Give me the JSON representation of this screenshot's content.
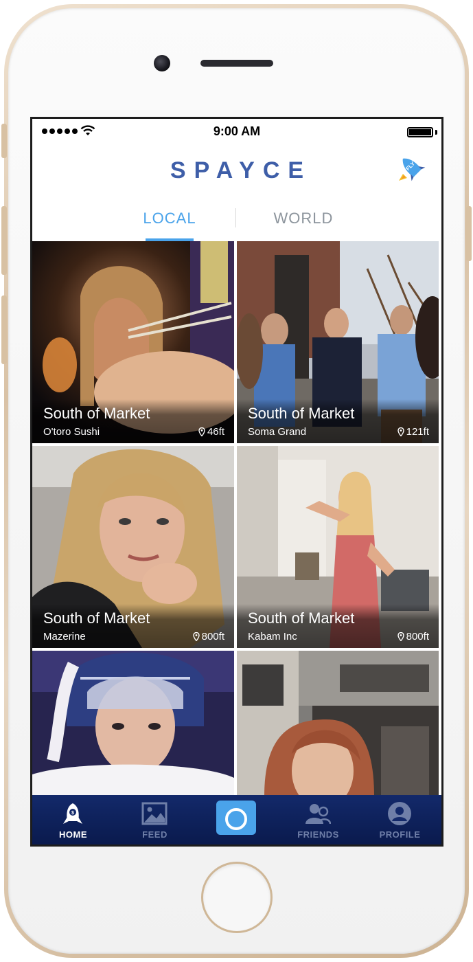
{
  "status_bar": {
    "time": "9:00 AM"
  },
  "header": {
    "logo": "SPAYCE",
    "fly_label": "FLY"
  },
  "tabs": {
    "local": "LOCAL",
    "world": "WORLD",
    "active": "local"
  },
  "tiles": [
    {
      "title": "South of Market",
      "subtitle": "O'toro Sushi",
      "distance": "46ft"
    },
    {
      "title": "South of Market",
      "subtitle": "Soma Grand",
      "distance": "121ft"
    },
    {
      "title": "South of Market",
      "subtitle": "Mazerine",
      "distance": "800ft"
    },
    {
      "title": "South of Market",
      "subtitle": "Kabam Inc",
      "distance": "800ft"
    }
  ],
  "tab_bar": {
    "home": "HOME",
    "feed": "FEED",
    "friends": "FRIENDS",
    "profile": "PROFILE"
  },
  "colors": {
    "brand": "#3e5ea8",
    "accent": "#4aa3ea",
    "tab_bar": "#0a1a4d"
  },
  "icons": {
    "home": "rocket-home-icon",
    "feed": "image-icon",
    "camera": "camera-icon",
    "friends": "friends-icon",
    "profile": "profile-icon",
    "fly": "rocket-icon",
    "pin": "location-pin-icon"
  }
}
